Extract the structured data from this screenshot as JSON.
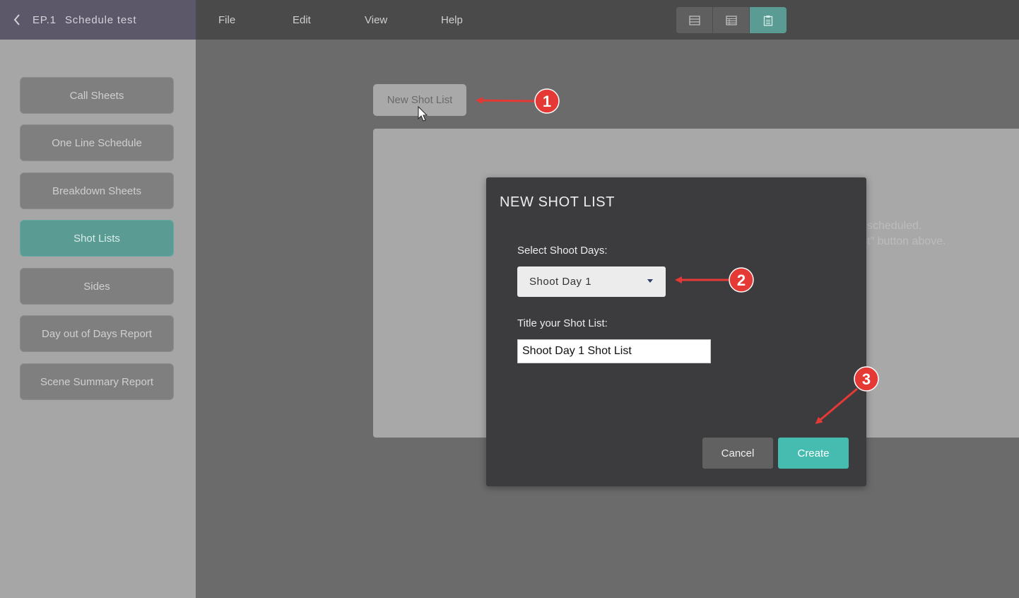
{
  "header": {
    "episode": "EP.1",
    "project_name": "Schedule test",
    "menu": [
      "File",
      "Edit",
      "View",
      "Help"
    ],
    "view_buttons": [
      "list-view-icon",
      "grid-view-icon",
      "clipboard-view-icon"
    ]
  },
  "sidebar": {
    "items": [
      {
        "label": "Call Sheets",
        "active": false
      },
      {
        "label": "One Line Schedule",
        "active": false
      },
      {
        "label": "Breakdown Sheets",
        "active": false
      },
      {
        "label": "Shot Lists",
        "active": true
      },
      {
        "label": "Sides",
        "active": false
      },
      {
        "label": "Day out of Days Report",
        "active": false
      },
      {
        "label": "Scene Summary Report",
        "active": false
      }
    ]
  },
  "main": {
    "new_button_label": "New Shot List",
    "empty_text_1": "scheduled.",
    "empty_text_2": "st\" button above."
  },
  "modal": {
    "title": "NEW SHOT LIST",
    "select_label": "Select Shoot Days:",
    "select_value": "Shoot Day 1",
    "title_label": "Title your Shot List:",
    "title_value": "Shoot Day 1 Shot List",
    "cancel_label": "Cancel",
    "create_label": "Create"
  },
  "annotations": [
    "1",
    "2",
    "3"
  ],
  "colors": {
    "accent": "#46bcb0",
    "active_sidebar": "#5a9b93",
    "annotation": "#e53935"
  }
}
